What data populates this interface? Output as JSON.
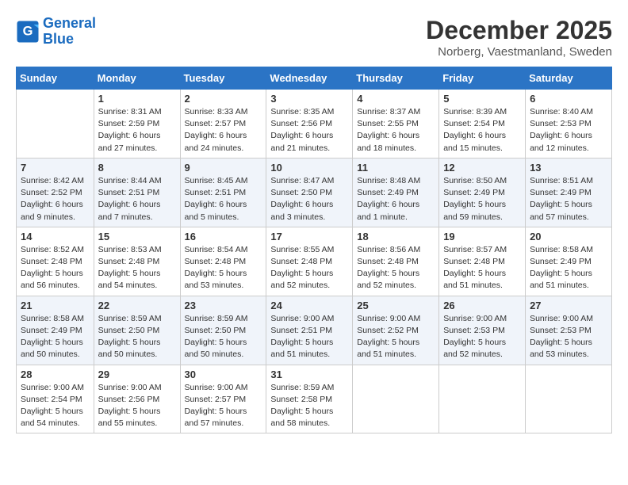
{
  "header": {
    "logo_line1": "General",
    "logo_line2": "Blue",
    "month": "December 2025",
    "location": "Norberg, Vaestmanland, Sweden"
  },
  "days_of_week": [
    "Sunday",
    "Monday",
    "Tuesday",
    "Wednesday",
    "Thursday",
    "Friday",
    "Saturday"
  ],
  "weeks": [
    [
      {
        "day": "",
        "sunrise": "",
        "sunset": "",
        "daylight": ""
      },
      {
        "day": "1",
        "sunrise": "8:31 AM",
        "sunset": "2:59 PM",
        "daylight": "6 hours and 27 minutes."
      },
      {
        "day": "2",
        "sunrise": "8:33 AM",
        "sunset": "2:57 PM",
        "daylight": "6 hours and 24 minutes."
      },
      {
        "day": "3",
        "sunrise": "8:35 AM",
        "sunset": "2:56 PM",
        "daylight": "6 hours and 21 minutes."
      },
      {
        "day": "4",
        "sunrise": "8:37 AM",
        "sunset": "2:55 PM",
        "daylight": "6 hours and 18 minutes."
      },
      {
        "day": "5",
        "sunrise": "8:39 AM",
        "sunset": "2:54 PM",
        "daylight": "6 hours and 15 minutes."
      },
      {
        "day": "6",
        "sunrise": "8:40 AM",
        "sunset": "2:53 PM",
        "daylight": "6 hours and 12 minutes."
      }
    ],
    [
      {
        "day": "7",
        "sunrise": "8:42 AM",
        "sunset": "2:52 PM",
        "daylight": "6 hours and 9 minutes."
      },
      {
        "day": "8",
        "sunrise": "8:44 AM",
        "sunset": "2:51 PM",
        "daylight": "6 hours and 7 minutes."
      },
      {
        "day": "9",
        "sunrise": "8:45 AM",
        "sunset": "2:51 PM",
        "daylight": "6 hours and 5 minutes."
      },
      {
        "day": "10",
        "sunrise": "8:47 AM",
        "sunset": "2:50 PM",
        "daylight": "6 hours and 3 minutes."
      },
      {
        "day": "11",
        "sunrise": "8:48 AM",
        "sunset": "2:49 PM",
        "daylight": "6 hours and 1 minute."
      },
      {
        "day": "12",
        "sunrise": "8:50 AM",
        "sunset": "2:49 PM",
        "daylight": "5 hours and 59 minutes."
      },
      {
        "day": "13",
        "sunrise": "8:51 AM",
        "sunset": "2:49 PM",
        "daylight": "5 hours and 57 minutes."
      }
    ],
    [
      {
        "day": "14",
        "sunrise": "8:52 AM",
        "sunset": "2:48 PM",
        "daylight": "5 hours and 56 minutes."
      },
      {
        "day": "15",
        "sunrise": "8:53 AM",
        "sunset": "2:48 PM",
        "daylight": "5 hours and 54 minutes."
      },
      {
        "day": "16",
        "sunrise": "8:54 AM",
        "sunset": "2:48 PM",
        "daylight": "5 hours and 53 minutes."
      },
      {
        "day": "17",
        "sunrise": "8:55 AM",
        "sunset": "2:48 PM",
        "daylight": "5 hours and 52 minutes."
      },
      {
        "day": "18",
        "sunrise": "8:56 AM",
        "sunset": "2:48 PM",
        "daylight": "5 hours and 52 minutes."
      },
      {
        "day": "19",
        "sunrise": "8:57 AM",
        "sunset": "2:48 PM",
        "daylight": "5 hours and 51 minutes."
      },
      {
        "day": "20",
        "sunrise": "8:58 AM",
        "sunset": "2:49 PM",
        "daylight": "5 hours and 51 minutes."
      }
    ],
    [
      {
        "day": "21",
        "sunrise": "8:58 AM",
        "sunset": "2:49 PM",
        "daylight": "5 hours and 50 minutes."
      },
      {
        "day": "22",
        "sunrise": "8:59 AM",
        "sunset": "2:50 PM",
        "daylight": "5 hours and 50 minutes."
      },
      {
        "day": "23",
        "sunrise": "8:59 AM",
        "sunset": "2:50 PM",
        "daylight": "5 hours and 50 minutes."
      },
      {
        "day": "24",
        "sunrise": "9:00 AM",
        "sunset": "2:51 PM",
        "daylight": "5 hours and 51 minutes."
      },
      {
        "day": "25",
        "sunrise": "9:00 AM",
        "sunset": "2:52 PM",
        "daylight": "5 hours and 51 minutes."
      },
      {
        "day": "26",
        "sunrise": "9:00 AM",
        "sunset": "2:53 PM",
        "daylight": "5 hours and 52 minutes."
      },
      {
        "day": "27",
        "sunrise": "9:00 AM",
        "sunset": "2:53 PM",
        "daylight": "5 hours and 53 minutes."
      }
    ],
    [
      {
        "day": "28",
        "sunrise": "9:00 AM",
        "sunset": "2:54 PM",
        "daylight": "5 hours and 54 minutes."
      },
      {
        "day": "29",
        "sunrise": "9:00 AM",
        "sunset": "2:56 PM",
        "daylight": "5 hours and 55 minutes."
      },
      {
        "day": "30",
        "sunrise": "9:00 AM",
        "sunset": "2:57 PM",
        "daylight": "5 hours and 57 minutes."
      },
      {
        "day": "31",
        "sunrise": "8:59 AM",
        "sunset": "2:58 PM",
        "daylight": "5 hours and 58 minutes."
      },
      {
        "day": "",
        "sunrise": "",
        "sunset": "",
        "daylight": ""
      },
      {
        "day": "",
        "sunrise": "",
        "sunset": "",
        "daylight": ""
      },
      {
        "day": "",
        "sunrise": "",
        "sunset": "",
        "daylight": ""
      }
    ]
  ]
}
